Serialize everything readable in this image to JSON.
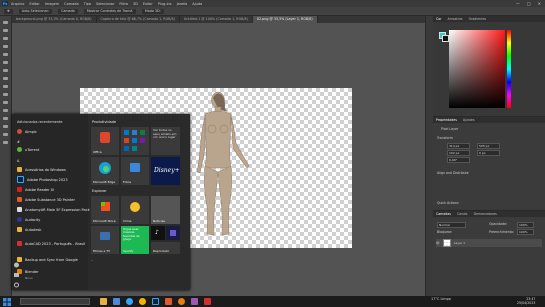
{
  "app": {
    "name": "Adobe Photoshop 2023"
  },
  "menubar": {
    "logo": "Ps",
    "items": [
      "Arquivo",
      "Editar",
      "Imagem",
      "Camada",
      "Tipo",
      "Selecionar",
      "Filtro",
      "3D",
      "Exibir",
      "Plug-ins",
      "Janela",
      "Ajuda"
    ],
    "window_controls": [
      "—",
      "□",
      "✕"
    ]
  },
  "optbar": {
    "items": [
      "Auto-Selecionar:",
      "Camada",
      "Mostrar Controles de Transf.",
      "Modo 3D:"
    ]
  },
  "tabs": [
    {
      "label": "background.png @ 33,3% (Camada 0, RGB/8)"
    },
    {
      "label": "Captura de tela @ 66,7% (Camada 1, RGB/8)"
    },
    {
      "label": "Untitled-1 @ 100% (Camada 1, RGB/8)"
    },
    {
      "label": "02.png @ 33,3% (Layer 1, RGB/8)",
      "active": true
    }
  ],
  "panels": {
    "color_tabs": [
      "Cor",
      "Amostras",
      "Gradientes"
    ],
    "properties_tabs": [
      "Propriedades",
      "Ajustes"
    ],
    "properties": {
      "type": "Pixel Layer",
      "transform_label": "Transform",
      "w": "314 px",
      "h": "505 px",
      "x": "102 px",
      "y": "0 px",
      "angle": "0,00°",
      "align_label": "Align and Distribute",
      "quick_actions": "Quick Actions"
    },
    "layers_tabs": [
      "Camadas",
      "Canais",
      "Demarcadores"
    ],
    "layers": {
      "blend_mode": "Normal",
      "opacity_label": "Opacidade:",
      "opacity": "100%",
      "lock_label": "Bloquear:",
      "fill_label": "Preenchimento:",
      "fill": "100%",
      "items": [
        "Layer 1"
      ]
    },
    "colors": {
      "foreground": "#2ad3c0",
      "background": "#111111"
    }
  },
  "startmenu": {
    "recent_header": "Adicionados recentemente",
    "items": [
      {
        "label": "Aimpic",
        "icon": "app-icon",
        "color": "#d34a3c"
      },
      {
        "label": "uTorrent",
        "icon": "utorrent-icon",
        "color": "#5fb63c",
        "section": "#"
      },
      {
        "label": "Acessórios do Windows",
        "icon": "folder-icon",
        "color": "#e7b33e",
        "section": "A"
      },
      {
        "label": "Adobe Photoshop 2023",
        "icon": "photoshop-icon",
        "color": "#31a8ff"
      },
      {
        "label": "Adobe Reader XI",
        "icon": "pdf-icon",
        "color": "#d21f1f"
      },
      {
        "label": "Adobe Substance 3D Painter",
        "icon": "substance-icon",
        "color": "#e05a2a"
      },
      {
        "label": "AnatomyAR Male 5F Expression Pack",
        "icon": "app-icon",
        "color": "#dddddd"
      },
      {
        "label": "Audacity",
        "icon": "audacity-icon",
        "color": "#2b3a8f"
      },
      {
        "label": "Autodesk",
        "icon": "folder-icon",
        "color": "#e7b33e"
      },
      {
        "label": "AutoCAD 2023 - Português - Brasil",
        "icon": "autocad-icon",
        "color": "#d32f2f"
      },
      {
        "label": "Backup and Sync from Google",
        "icon": "folder-icon",
        "color": "#e7b33e"
      },
      {
        "label": "Blender",
        "icon": "blender-icon",
        "color": "#e87d0d",
        "sub": "Novo"
      }
    ],
    "sections": {
      "productivity": "Produtividade",
      "explore": "Explorar"
    },
    "tiles": [
      {
        "label": "Office",
        "color": "#3a3a3a"
      },
      {
        "label": "",
        "color": "#3a3a3a"
      },
      {
        "label": "Ver todos os seus emails em um único lugar",
        "color": "#3a3a3a"
      },
      {
        "label": "Microsoft Edge",
        "color": "#3a3a3a"
      },
      {
        "label": "Fotos",
        "color": "#3a3a3a"
      },
      {
        "label": "Disney+",
        "color": "#0b1a4a"
      },
      {
        "label": "Microsoft Store",
        "color": "#3a3a3a"
      },
      {
        "label": "Clima",
        "color": "#3a3a3a"
      },
      {
        "label": "Notícias",
        "color": "#3a3a3a"
      },
      {
        "label": "Filmes e TV",
        "color": "#3a3a3a"
      },
      {
        "label": "Spotify",
        "color": "#1db954",
        "text": "Toque suas músicas favoritas de graça."
      },
      {
        "label": "TikTok",
        "color": "#111111"
      },
      {
        "label": "Reproduzir",
        "color": "#3a3a3a"
      }
    ]
  },
  "taskbar": {
    "icons": [
      {
        "name": "start-icon",
        "color": "#3a8ee6"
      },
      {
        "name": "explorer-icon",
        "color": "#e7b33e"
      },
      {
        "name": "store-icon",
        "color": "#4a8ad8"
      },
      {
        "name": "edge-icon",
        "color": "#31a8ff"
      },
      {
        "name": "chrome-icon",
        "color": "#f4b400"
      },
      {
        "name": "photoshop-icon",
        "color": "#0c233f"
      },
      {
        "name": "substance-icon",
        "color": "#e05a2a"
      },
      {
        "name": "blender-icon",
        "color": "#e87d0d"
      },
      {
        "name": "app-icon",
        "color": "#9b59b6"
      },
      {
        "name": "app-icon",
        "color": "#d32f2f"
      }
    ],
    "weather": "17°C  Limpo",
    "time": "23:47",
    "date": "25/04/2023"
  }
}
